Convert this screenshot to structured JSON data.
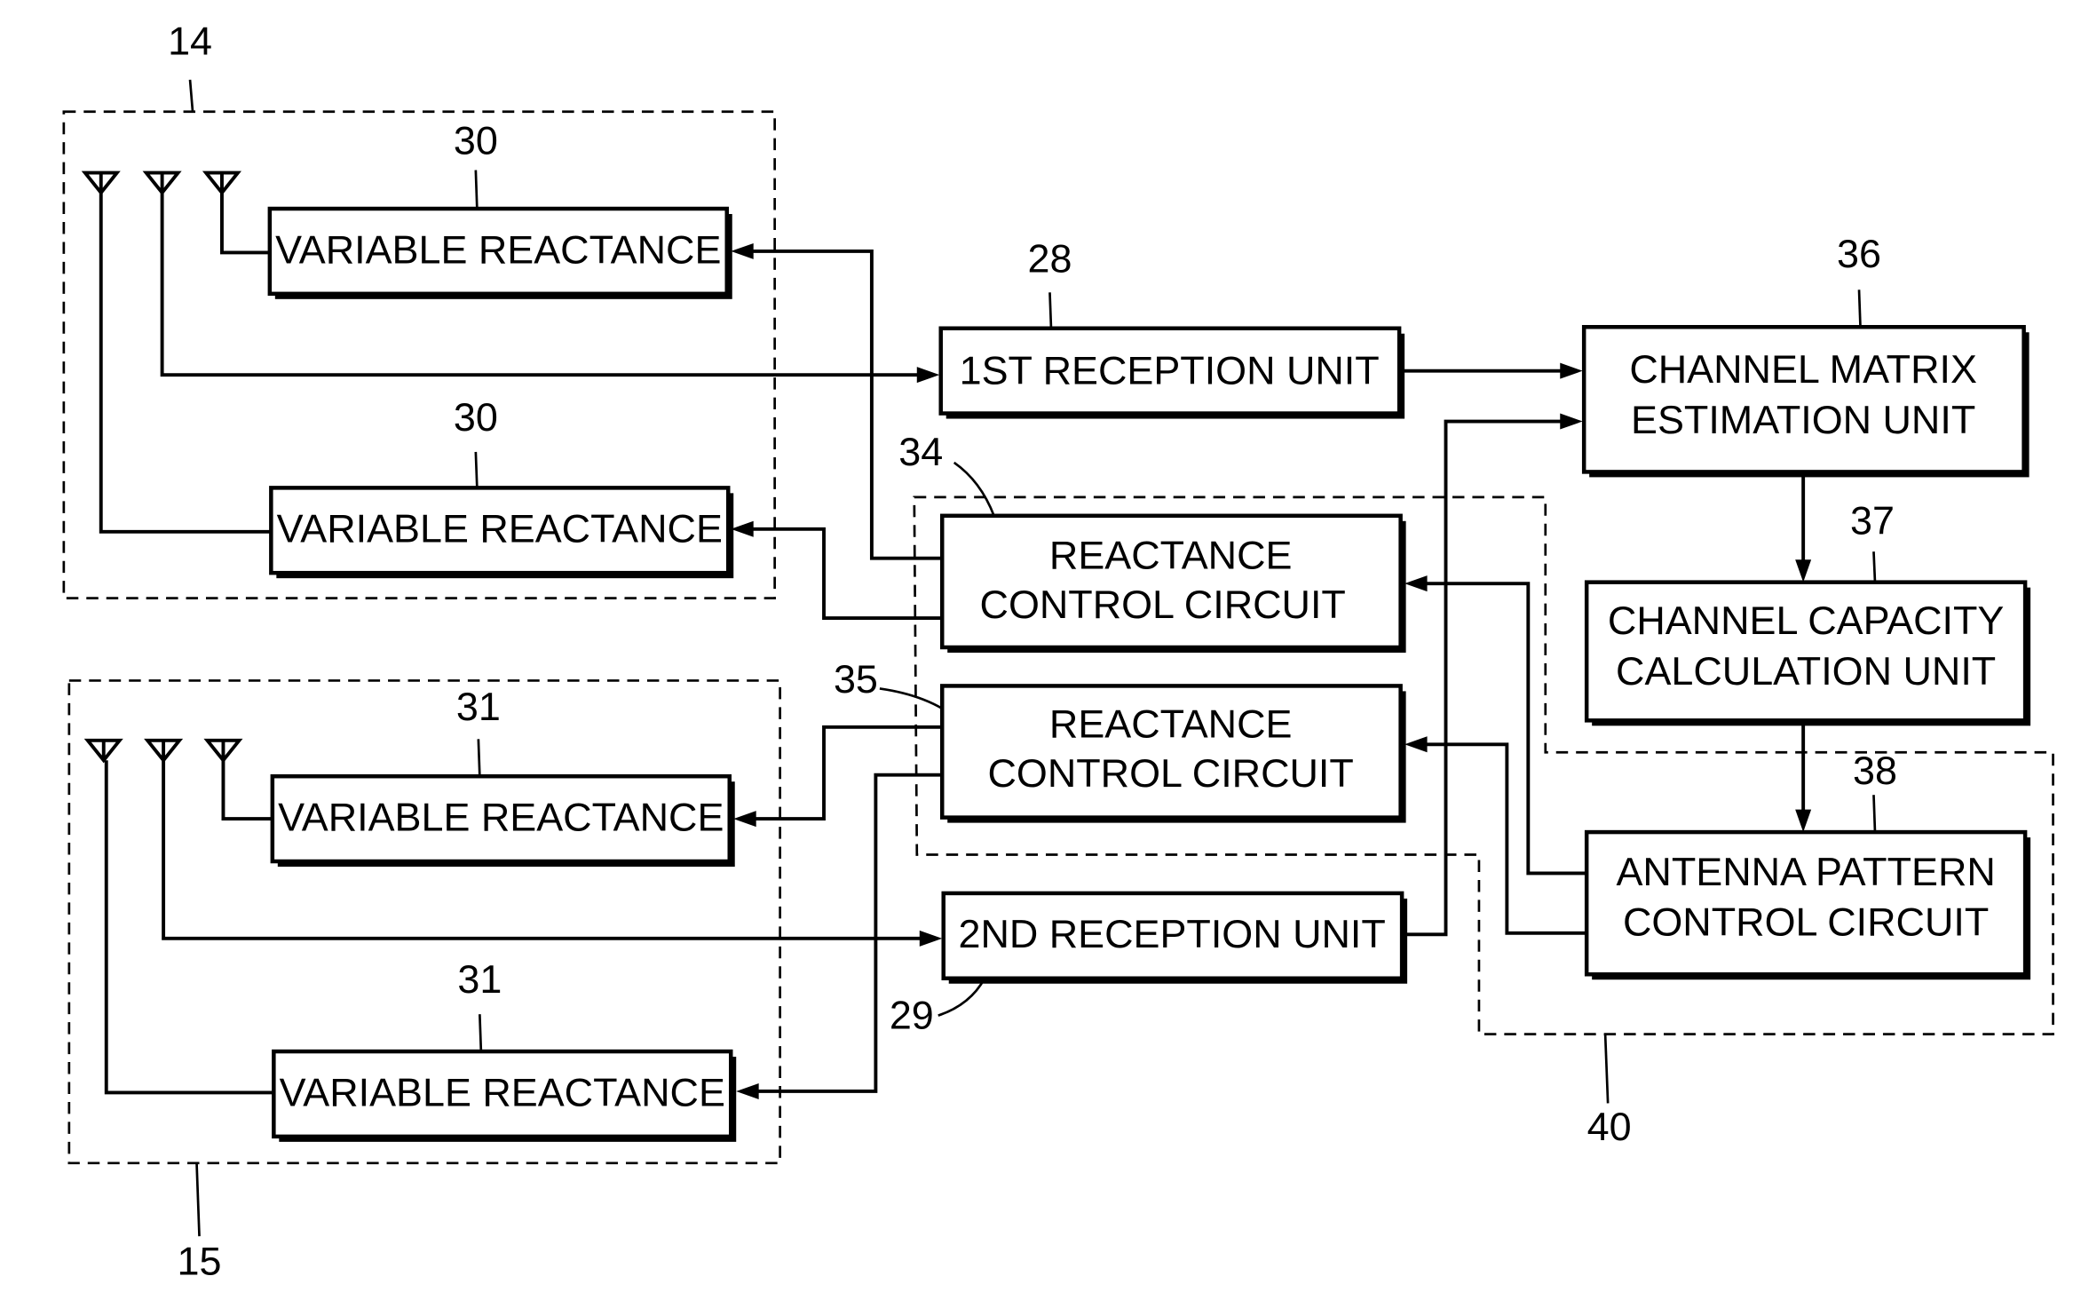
{
  "diagram": {
    "groups": {
      "g14": {
        "ref": "14"
      },
      "g15": {
        "ref": "15"
      },
      "g34": {
        "ref": "34"
      },
      "g35": {
        "ref": "35"
      },
      "g40": {
        "ref": "40"
      }
    },
    "blocks": {
      "vr30a": {
        "ref": "30",
        "lines": [
          "VARIABLE REACTANCE"
        ]
      },
      "vr30b": {
        "ref": "30",
        "lines": [
          "VARIABLE REACTANCE"
        ]
      },
      "vr31a": {
        "ref": "31",
        "lines": [
          "VARIABLE REACTANCE"
        ]
      },
      "vr31b": {
        "ref": "31",
        "lines": [
          "VARIABLE REACTANCE"
        ]
      },
      "rx28": {
        "ref": "28",
        "lines": [
          "1ST RECEPTION UNIT"
        ]
      },
      "rx29": {
        "ref": "29",
        "lines": [
          "2ND RECEPTION UNIT"
        ]
      },
      "rc34": {
        "lines": [
          "REACTANCE",
          "CONTROL CIRCUIT"
        ]
      },
      "rc35": {
        "lines": [
          "REACTANCE",
          "CONTROL CIRCUIT"
        ]
      },
      "cm36": {
        "ref": "36",
        "lines": [
          "CHANNEL MATRIX",
          "ESTIMATION UNIT"
        ]
      },
      "cc37": {
        "ref": "37",
        "lines": [
          "CHANNEL CAPACITY",
          "CALCULATION UNIT"
        ]
      },
      "ap38": {
        "ref": "38",
        "lines": [
          "ANTENNA PATTERN",
          "CONTROL CIRCUIT"
        ]
      }
    },
    "antenna_count_per_array": 3
  }
}
